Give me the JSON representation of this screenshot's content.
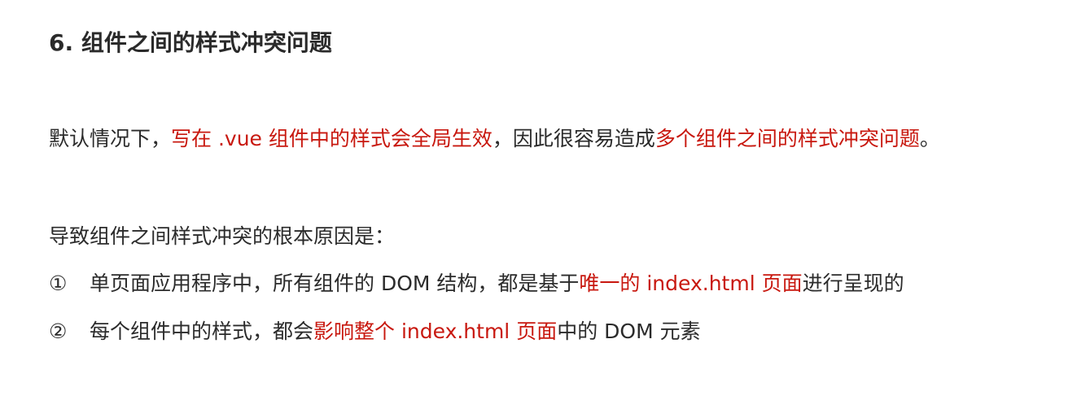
{
  "heading": "6. 组件之间的样式冲突问题",
  "paragraph1": {
    "part1": "默认情况下，",
    "highlight1": "写在 .vue 组件中的样式会全局生效",
    "part2": "，因此很容易造成",
    "highlight2": "多个组件之间的样式冲突问题",
    "part3": "。"
  },
  "paragraph2": "导致组件之间样式冲突的根本原因是：",
  "items": [
    {
      "number": "①",
      "before": "单页面应用程序中，所有组件的 DOM 结构，都是基于",
      "highlight": "唯一的 index.html 页面",
      "after": "进行呈现的"
    },
    {
      "number": "②",
      "before": "每个组件中的样式，都会",
      "highlight": "影响整个 index.html 页面",
      "after": "中的 DOM 元素"
    }
  ],
  "colors": {
    "text": "#2b2b2b",
    "highlight": "#c8180f",
    "background": "#ffffff"
  }
}
